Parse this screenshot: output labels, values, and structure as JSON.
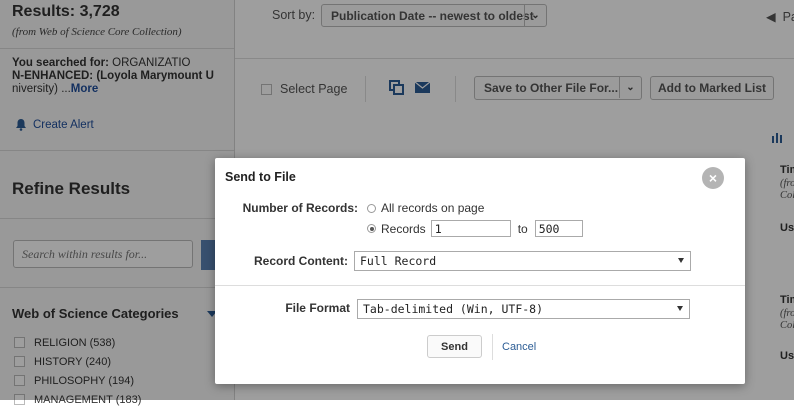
{
  "results": {
    "count": "Results: 3,728",
    "source": "(from Web of Science Core Collection)"
  },
  "search": {
    "label": "You searched for:",
    "query_line1": "ORGANIZATIO",
    "query_line2": "N-ENHANCED: (Loyola Marymount U",
    "query_line3": "niversity) ...",
    "more": "More"
  },
  "create_alert": "Create Alert",
  "refine": {
    "title": "Refine Results",
    "search_placeholder": "Search within results for..."
  },
  "wos_categories": {
    "title": "Web of Science Categories",
    "items": [
      {
        "label": "RELIGION (538)"
      },
      {
        "label": "HISTORY (240)"
      },
      {
        "label": "PHILOSOPHY (194)"
      },
      {
        "label": "MANAGEMENT (183)"
      }
    ]
  },
  "sort": {
    "label": "Sort by:",
    "value": "Publication Date -- newest to oldest"
  },
  "paging": {
    "label": "Pa"
  },
  "toolbar": {
    "select_page": "Select Page",
    "save_to_file": "Save to Other File For...",
    "add_to_marked": "Add to Marked List"
  },
  "right_cards": {
    "c1_title": "Tim",
    "c1_line2": "(fro",
    "c1_line3": "Coll",
    "c1_usage": "Usa",
    "c2_title": "Tim",
    "c2_line2": "(fro",
    "c2_line3": "Coll",
    "c2_usage": "Usa"
  },
  "modal": {
    "title": "Send to File",
    "close": "×",
    "num_records_label": "Number of Records:",
    "all_records": "All records on page",
    "records_label": "Records",
    "records_from": "1",
    "records_to_word": "to",
    "records_to": "500",
    "content_label": "Record Content:",
    "content_value": "Full Record",
    "format_label": "File Format",
    "format_value": "Tab-delimited (Win, UTF-8)",
    "send": "Send",
    "cancel": "Cancel"
  },
  "colors": {
    "link_blue": "#1f4e9c",
    "icon_blue": "#2c5d95",
    "overlay": "rgba(0,0,0,0.38)"
  }
}
